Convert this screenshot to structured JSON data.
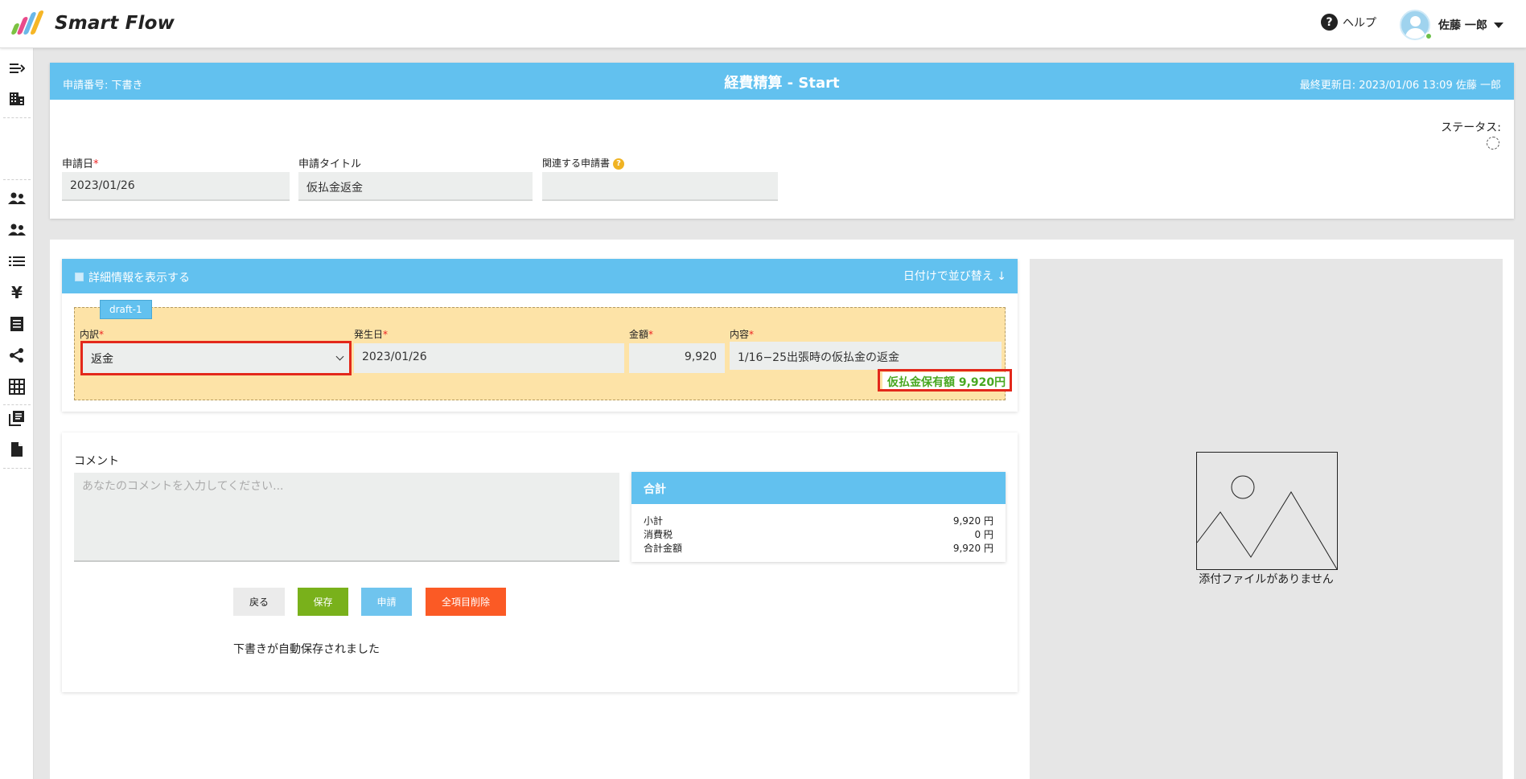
{
  "app": {
    "name": "Smart Flow"
  },
  "header": {
    "help_label": "ヘルプ",
    "user_name": "佐藤 一郎"
  },
  "form_header": {
    "application_number": "申請番号: 下書き",
    "title": "経費精算 - Start",
    "last_updated": "最終更新日: 2023/01/06 13:09 佐藤 一郎",
    "status_label": "ステータス:"
  },
  "fields": {
    "application_date": {
      "label": "申請日",
      "value": "2023/01/26"
    },
    "application_title": {
      "label": "申請タイトル",
      "value": "仮払金返金"
    },
    "related_application": {
      "label": "関連する申請書",
      "value": ""
    }
  },
  "details": {
    "toggle_label": "詳細情報を表示する",
    "sort_label": "日付けで並び替え",
    "draft_tag": "draft-1",
    "columns": {
      "category": "内訳",
      "date": "発生日",
      "amount": "金額",
      "content": "内容"
    },
    "row": {
      "category": "返金",
      "date": "2023/01/26",
      "amount": "9,920",
      "content": "1/16−25出張時の仮払金の返金"
    },
    "advance_balance": "仮払金保有額 9,920円"
  },
  "comment": {
    "label": "コメント",
    "placeholder": "あなたのコメントを入力してください..."
  },
  "totals": {
    "title": "合計",
    "rows": [
      {
        "label": "小計",
        "value": "9,920 円"
      },
      {
        "label": "消費税",
        "value": "0 円"
      },
      {
        "label": "合計金額",
        "value": "9,920 円"
      }
    ]
  },
  "buttons": {
    "back": "戻る",
    "save": "保存",
    "apply": "申請",
    "delete_all": "全項目削除"
  },
  "autosave_message": "下書きが自動保存されました",
  "attachment": {
    "empty_text": "添付ファイルがありません"
  },
  "sidebar_icons": [
    "expand-menu-icon",
    "building-icon",
    "people-icon",
    "people-icon",
    "list-icon",
    "yen-icon",
    "document-list-icon",
    "share-icon",
    "grid-icon",
    "library-icon",
    "file-icon"
  ],
  "colors": {
    "primary_blue": "#62c1ef",
    "save_green": "#79b11b",
    "apply_blue": "#6fc4ee",
    "delete_orange": "#fb5a25",
    "draft_bg": "#fde3a7",
    "highlight_red": "#e3281b",
    "balance_green": "#48a821"
  }
}
